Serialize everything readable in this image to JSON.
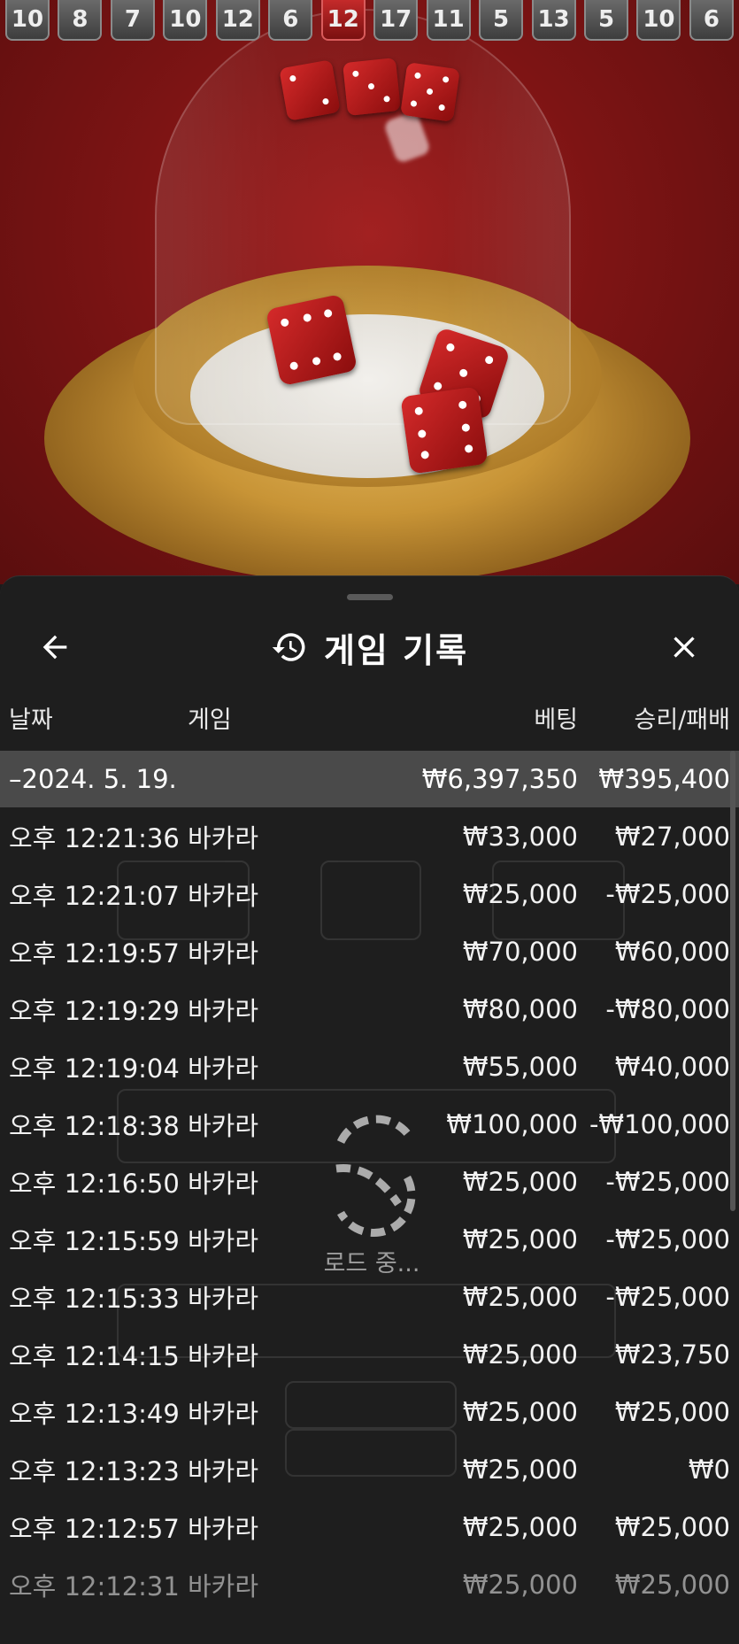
{
  "results_strip": [
    "10",
    "8",
    "7",
    "10",
    "12",
    "6",
    "12",
    "17",
    "11",
    "5",
    "13",
    "5",
    "10",
    "6"
  ],
  "highlight_index": 6,
  "header": {
    "title": "게임 기록",
    "back_icon": "arrow-left-icon",
    "history_icon": "history-clock-icon",
    "close_icon": "close-x-icon"
  },
  "columns": {
    "date": "날짜",
    "game": "게임",
    "bet": "베팅",
    "win_loss": "승리/패배"
  },
  "date_group": {
    "label": "–2024. 5. 19.",
    "bet_total": "₩6,397,350",
    "win_total": "₩395,400"
  },
  "rows": [
    {
      "time": "오후 12:21:36",
      "game": "바카라",
      "bet": "₩33,000",
      "result": "₩27,000"
    },
    {
      "time": "오후 12:21:07",
      "game": "바카라",
      "bet": "₩25,000",
      "result": "-₩25,000"
    },
    {
      "time": "오후 12:19:57",
      "game": "바카라",
      "bet": "₩70,000",
      "result": "₩60,000"
    },
    {
      "time": "오후 12:19:29",
      "game": "바카라",
      "bet": "₩80,000",
      "result": "-₩80,000"
    },
    {
      "time": "오후 12:19:04",
      "game": "바카라",
      "bet": "₩55,000",
      "result": "₩40,000"
    },
    {
      "time": "오후 12:18:38",
      "game": "바카라",
      "bet": "₩100,000",
      "result": "-₩100,000"
    },
    {
      "time": "오후 12:16:50",
      "game": "바카라",
      "bet": "₩25,000",
      "result": "-₩25,000"
    },
    {
      "time": "오후 12:15:59",
      "game": "바카라",
      "bet": "₩25,000",
      "result": "-₩25,000"
    },
    {
      "time": "오후 12:15:33",
      "game": "바카라",
      "bet": "₩25,000",
      "result": "-₩25,000"
    },
    {
      "time": "오후 12:14:15",
      "game": "바카라",
      "bet": "₩25,000",
      "result": "₩23,750"
    },
    {
      "time": "오후 12:13:49",
      "game": "바카라",
      "bet": "₩25,000",
      "result": "₩25,000"
    },
    {
      "time": "오후 12:13:23",
      "game": "바카라",
      "bet": "₩25,000",
      "result": "₩0"
    },
    {
      "time": "오후 12:12:57",
      "game": "바카라",
      "bet": "₩25,000",
      "result": "₩25,000"
    },
    {
      "time": "오후 12:12:31",
      "game": "바카라",
      "bet": "₩25,000",
      "result": "₩25,000"
    }
  ],
  "loading": {
    "text": "로드 중...",
    "icon": "spinner-icon"
  }
}
